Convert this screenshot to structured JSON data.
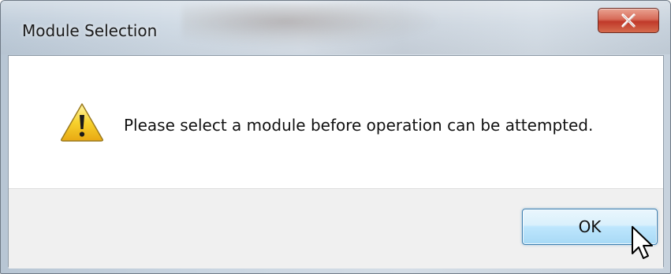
{
  "dialog": {
    "title": "Module Selection",
    "message": "Please select a module before operation can be attempted.",
    "ok_label": "OK"
  },
  "icons": {
    "message_icon": "warning-icon",
    "close_icon": "close-icon",
    "pointer": "mouse-pointer-icon"
  },
  "colors": {
    "close_button": "#c7463a",
    "ok_button_border": "#3c7fb1",
    "warning_yellow": "#f5c518"
  }
}
